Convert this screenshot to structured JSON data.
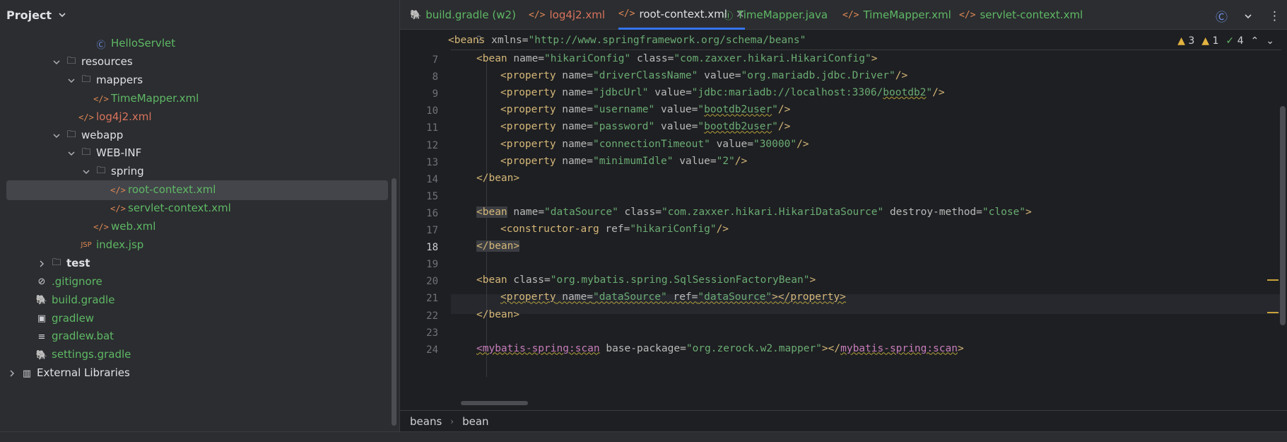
{
  "project": {
    "title": "Project",
    "tree": [
      {
        "label": "HelloServlet",
        "icon": "class-icon",
        "color": "green",
        "indent": 155,
        "arrow": "none"
      },
      {
        "label": "resources",
        "icon": "resources-folder-icon",
        "color": "white",
        "indent": 113,
        "arrow": "down"
      },
      {
        "label": "mappers",
        "icon": "folder-icon",
        "color": "white",
        "indent": 134,
        "arrow": "down"
      },
      {
        "label": "TimeMapper.xml",
        "icon": "xml-file-icon",
        "color": "green",
        "indent": 155,
        "arrow": "none"
      },
      {
        "label": "log4j2.xml",
        "icon": "xml-file-icon",
        "color": "red",
        "indent": 134,
        "arrow": "none"
      },
      {
        "label": "webapp",
        "icon": "web-folder-icon",
        "color": "white",
        "indent": 113,
        "arrow": "down"
      },
      {
        "label": "WEB-INF",
        "icon": "folder-icon",
        "color": "white",
        "indent": 134,
        "arrow": "down"
      },
      {
        "label": "spring",
        "icon": "folder-icon",
        "color": "white",
        "indent": 155,
        "arrow": "down"
      },
      {
        "label": "root-context.xml",
        "icon": "spring-xml-icon",
        "color": "green",
        "indent": 179,
        "arrow": "none",
        "selected": true
      },
      {
        "label": "servlet-context.xml",
        "icon": "spring-xml-icon",
        "color": "green",
        "indent": 179,
        "arrow": "none"
      },
      {
        "label": "web.xml",
        "icon": "web-xml-icon",
        "color": "green",
        "indent": 155,
        "arrow": "none"
      },
      {
        "label": "index.jsp",
        "icon": "jsp-file-icon",
        "color": "green",
        "indent": 134,
        "arrow": "none"
      },
      {
        "label": "test",
        "icon": "test-folder-icon",
        "color": "white",
        "indent": 92,
        "arrow": "right",
        "bold": true
      },
      {
        "label": ".gitignore",
        "icon": "ignore-file-icon",
        "color": "green",
        "indent": 71,
        "arrow": "none"
      },
      {
        "label": "build.gradle",
        "icon": "gradle-icon",
        "color": "green",
        "indent": 71,
        "arrow": "none"
      },
      {
        "label": "gradlew",
        "icon": "terminal-file-icon",
        "color": "green",
        "indent": 71,
        "arrow": "none"
      },
      {
        "label": "gradlew.bat",
        "icon": "text-file-icon",
        "color": "green",
        "indent": 71,
        "arrow": "none"
      },
      {
        "label": "settings.gradle",
        "icon": "gradle-icon",
        "color": "green",
        "indent": 71,
        "arrow": "none"
      },
      {
        "label": "External Libraries",
        "icon": "library-icon",
        "color": "white",
        "indent": 50,
        "arrow": "right"
      }
    ]
  },
  "tabs": [
    {
      "label": "build.gradle (w2)",
      "icon": "gradle-icon",
      "color": "#5fb865"
    },
    {
      "label": "log4j2.xml",
      "icon": "xml-file-icon",
      "color": "#d9735c"
    },
    {
      "label": "root-context.xml",
      "icon": "xml-file-icon",
      "color": "#dfe1e5",
      "active": true
    },
    {
      "label": "TimeMapper.java",
      "icon": "interface-icon",
      "color": "#5fb865"
    },
    {
      "label": "TimeMapper.xml",
      "icon": "xml-file-icon",
      "color": "#5fb865"
    },
    {
      "label": "servlet-context.xml",
      "icon": "xml-file-icon",
      "color": "#5fb865"
    }
  ],
  "inspections": {
    "warnings": "3",
    "weak_warnings": "1",
    "typos": "4"
  },
  "code": {
    "sticky": {
      "line": "2"
    },
    "lines": [
      "7",
      "8",
      "9",
      "10",
      "11",
      "12",
      "13",
      "14",
      "15",
      "16",
      "17",
      "18",
      "19",
      "20",
      "21",
      "22",
      "23",
      "24"
    ],
    "current_line": "18",
    "text": {
      "l2a": "<beans",
      "l2b": " xmlns",
      "l2c": "=",
      "l2d": "\"http://www.springframework.org/schema/beans\"",
      "l7": [
        "<bean",
        " name",
        "=",
        "\"hikariConfig\"",
        " class",
        "=",
        "\"com.zaxxer.hikari.HikariConfig\"",
        ">"
      ],
      "l8": [
        "<property",
        " name",
        "=",
        "\"driverClassName\"",
        " value",
        "=",
        "\"org.mariadb.jdbc.Driver\"",
        "/>"
      ],
      "l9a": [
        "<property",
        " name",
        "=",
        "\"jdbcUrl\"",
        " value",
        "="
      ],
      "l9b": "\"jdbc:mariadb://localhost:3306/",
      "l9c": "bootdb2",
      "l9d": "\"",
      "l9e": "/>",
      "l10a": [
        "<property",
        " name",
        "=",
        "\"username\"",
        " value",
        "="
      ],
      "l10b": "\"",
      "l10c": "bootdb2user",
      "l10d": "\"",
      "l10e": "/>",
      "l11a": [
        "<property",
        " name",
        "=",
        "\"password\"",
        " value",
        "="
      ],
      "l11b": "\"",
      "l11c": "bootdb2user",
      "l11d": "\"",
      "l11e": "/>",
      "l12": [
        "<property",
        " name",
        "=",
        "\"connectionTimeout\"",
        " value",
        "=",
        "\"30000\"",
        "/>"
      ],
      "l13": [
        "<property",
        " name",
        "=",
        "\"minimumIdle\"",
        " value",
        "=",
        "\"2\"",
        "/>"
      ],
      "l14": "</bean>",
      "l16a": "<bean",
      "l16b": [
        " name",
        "=",
        "\"dataSource\"",
        " class",
        "=",
        "\"com.zaxxer.hikari.HikariDataSource\"",
        " destroy-method",
        "=",
        "\"close\"",
        ">"
      ],
      "l17": [
        "<constructor-arg",
        " ref",
        "=",
        "\"hikariConfig\"",
        "/>"
      ],
      "l18": "</bean>",
      "l20": [
        "<bean",
        " class",
        "=",
        "\"org.mybatis.spring.SqlSessionFactoryBean\"",
        ">"
      ],
      "l21": [
        "<property",
        " name",
        "=",
        "\"dataSource\"",
        " ref",
        "=",
        "\"dataSource\"",
        "></property>"
      ],
      "l22": "</bean>",
      "l24": [
        "<mybatis-spring:scan",
        " base-package",
        "=",
        "\"org.zerock.w2.mapper\"",
        "></",
        "mybatis-spring:scan",
        ">"
      ]
    }
  },
  "breadcrumb": [
    "beans",
    "bean"
  ]
}
